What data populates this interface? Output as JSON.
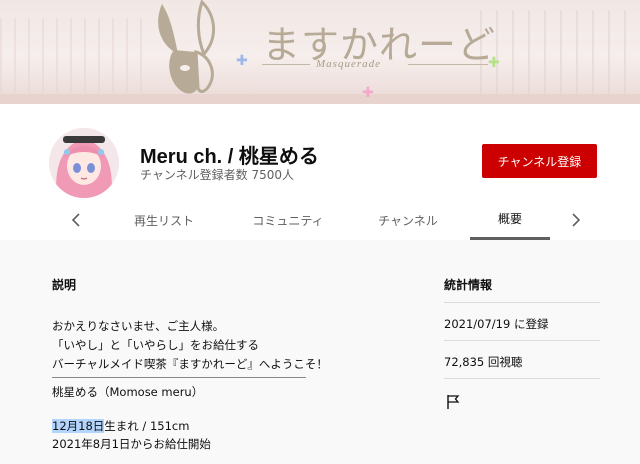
{
  "banner": {
    "logo_title": "ますかれーど",
    "logo_subtitle": "Masquerade"
  },
  "channel": {
    "name": "Meru ch. / 桃星める",
    "subscribers": "チャンネル登録者数 7500人",
    "subscribe_label": "チャンネル登録"
  },
  "tabs": {
    "items": [
      {
        "label": "再生リスト"
      },
      {
        "label": "コミュニティ"
      },
      {
        "label": "チャンネル"
      },
      {
        "label": "概要",
        "active": true
      }
    ],
    "prev_icon": "chevron-left-icon",
    "next_icon": "chevron-right-icon"
  },
  "about": {
    "description_heading": "説明",
    "lines": [
      "おかえりなさいませ、ご主人様。",
      "「いやし」と「いやらし」をお給仕する",
      "バーチャルメイド喫茶『ますかれーど』へようこそ！",
      "桃星める（Momose meru）",
      "12月18日",
      "生まれ / 151cm",
      "2021年8月1日からお給仕開始"
    ],
    "stats_heading": "統計情報",
    "joined": "2021/07/19 に登録",
    "views": "72,835 回視聴",
    "report_icon": "flag-icon"
  },
  "colors": {
    "subscribe": "#cc0000",
    "highlight": "#b3d4fc",
    "logo": "#b7ab97"
  }
}
